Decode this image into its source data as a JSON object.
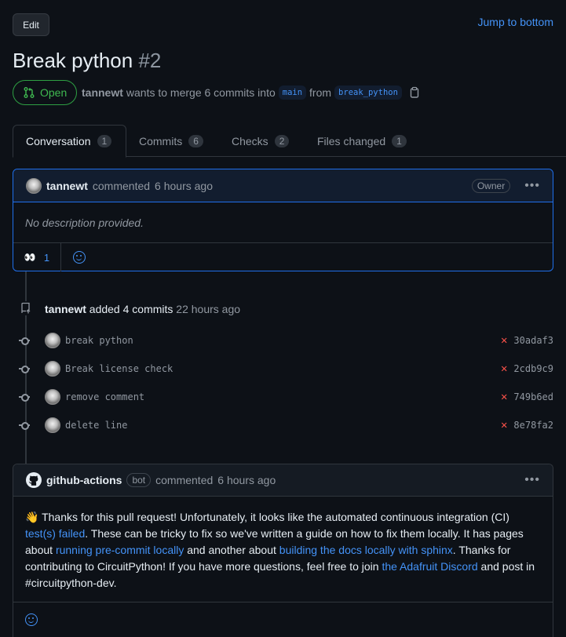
{
  "header": {
    "edit_label": "Edit",
    "jump_label": "Jump to bottom",
    "title": "Break python",
    "number": "#2"
  },
  "pr_meta": {
    "state": "Open",
    "author": "tannewt",
    "text_before": "wants to merge 6 commits into",
    "base_branch": "main",
    "from_text": "from",
    "head_branch": "break_python"
  },
  "tabs": [
    {
      "label": "Conversation",
      "count": "1"
    },
    {
      "label": "Commits",
      "count": "6"
    },
    {
      "label": "Checks",
      "count": "2"
    },
    {
      "label": "Files changed",
      "count": "1"
    }
  ],
  "first_comment": {
    "author": "tannewt",
    "action": "commented",
    "time": "6 hours ago",
    "badge": "Owner",
    "body": "No description provided.",
    "reaction_count": "1"
  },
  "commits_event": {
    "author": "tannewt",
    "action": "added 4 commits",
    "time": "22 hours ago",
    "commits": [
      {
        "message": "break python",
        "sha": "30adaf3"
      },
      {
        "message": "Break license check",
        "sha": "2cdb9c9"
      },
      {
        "message": "remove comment",
        "sha": "749b6ed"
      },
      {
        "message": "delete line",
        "sha": "8e78fa2"
      }
    ]
  },
  "bot_comment": {
    "author": "github-actions",
    "badge": "bot",
    "action": "commented",
    "time": "6 hours ago",
    "emoji": "👋",
    "p1": "Thanks for this pull request! Unfortunately, it looks like the automated continuous integration (CI) ",
    "link1": "test(s) failed",
    "p2": ". These can be tricky to fix so we've written a guide on how to fix them locally. It has pages about ",
    "link2": "running pre-commit locally",
    "p3": " and another about ",
    "link3": "building the docs locally with sphinx",
    "p4": ". Thanks for contributing to CircuitPython! If you have more questions, feel free to join ",
    "link4": "the Adafruit Discord",
    "p5": " and post in #circuitpython-dev."
  },
  "colors": {
    "accent": "#4493f8",
    "open_green": "#3fb950",
    "fail_red": "#f85149"
  }
}
